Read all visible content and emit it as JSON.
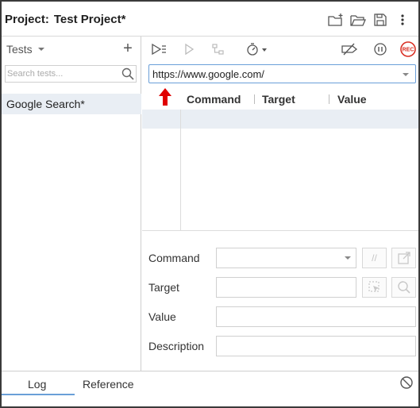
{
  "header": {
    "project_label": "Project:",
    "project_name": "Test Project*",
    "icons": [
      "new-project-icon",
      "open-project-icon",
      "save-project-icon",
      "more-options-icon"
    ]
  },
  "sidebar": {
    "section_label": "Tests",
    "add_label": "+",
    "search_placeholder": "Search tests...",
    "tests": [
      {
        "name": "Google Search*",
        "selected": true
      }
    ]
  },
  "toolbar": {
    "icons": [
      "run-all-tests-icon",
      "run-current-test-icon",
      "step-icon",
      "speed-icon",
      "disable-breakpoints-icon",
      "pause-icon",
      "record-icon"
    ],
    "record_label": "REC"
  },
  "url_bar": {
    "value": "https://www.google.com/"
  },
  "table": {
    "columns": [
      "Command",
      "Target",
      "Value"
    ]
  },
  "editor": {
    "command_label": "Command",
    "target_label": "Target",
    "value_label": "Value",
    "description_label": "Description",
    "comment_button": "//"
  },
  "bottom": {
    "tabs": [
      "Log",
      "Reference"
    ],
    "active_tab": "Log"
  },
  "colors": {
    "accent": "#6a9fd8",
    "selection": "#e9eef4",
    "record_red": "#d93025",
    "arrow_red": "#e00000"
  }
}
